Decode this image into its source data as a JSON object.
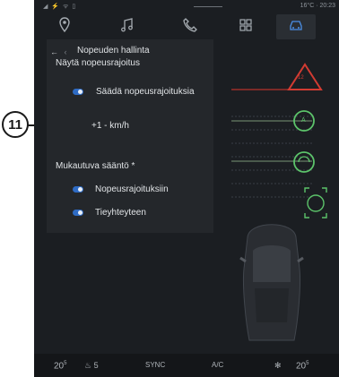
{
  "callout": {
    "number": "11"
  },
  "status": {
    "left_icons": "◢ ⚡ ᯤ ▯",
    "temp_time": "16°C · 20:23"
  },
  "nav": {
    "items": [
      {
        "name": "navigation",
        "icon": "location-pin-icon"
      },
      {
        "name": "music",
        "icon": "music-note-icon"
      },
      {
        "name": "phone",
        "icon": "phone-icon"
      },
      {
        "name": "apps",
        "icon": "apps-grid-icon"
      },
      {
        "name": "vehicle",
        "icon": "car-icon",
        "active": true
      }
    ]
  },
  "header": {
    "back_arrow": "←",
    "breadcrumb_dot": "‹",
    "title": "Nopeuden hallinta",
    "subtitle": "Näytä nopeusrajoitus"
  },
  "settings": {
    "adjust_label": "Säädä nopeusrajoituksia",
    "speed_offset": "+1 - km/h",
    "adaptive_title": "Mukautuva sääntö *",
    "option_limits": "Nopeusrajoituksiin",
    "option_road": "Tieyhteyteen"
  },
  "indicators": {
    "warning_text": "12",
    "accel_text": "A"
  },
  "bottom": {
    "left_temp": "20",
    "left_temp_unit": "5",
    "seat_heat": "5",
    "sync": "SYNC",
    "ac": "A/C",
    "right_temp": "20",
    "right_temp_unit": "5"
  },
  "colors": {
    "accent": "#2e6bc4",
    "warning": "#d23b32",
    "assist": "#5cc36a",
    "background": "#1b1e22"
  }
}
